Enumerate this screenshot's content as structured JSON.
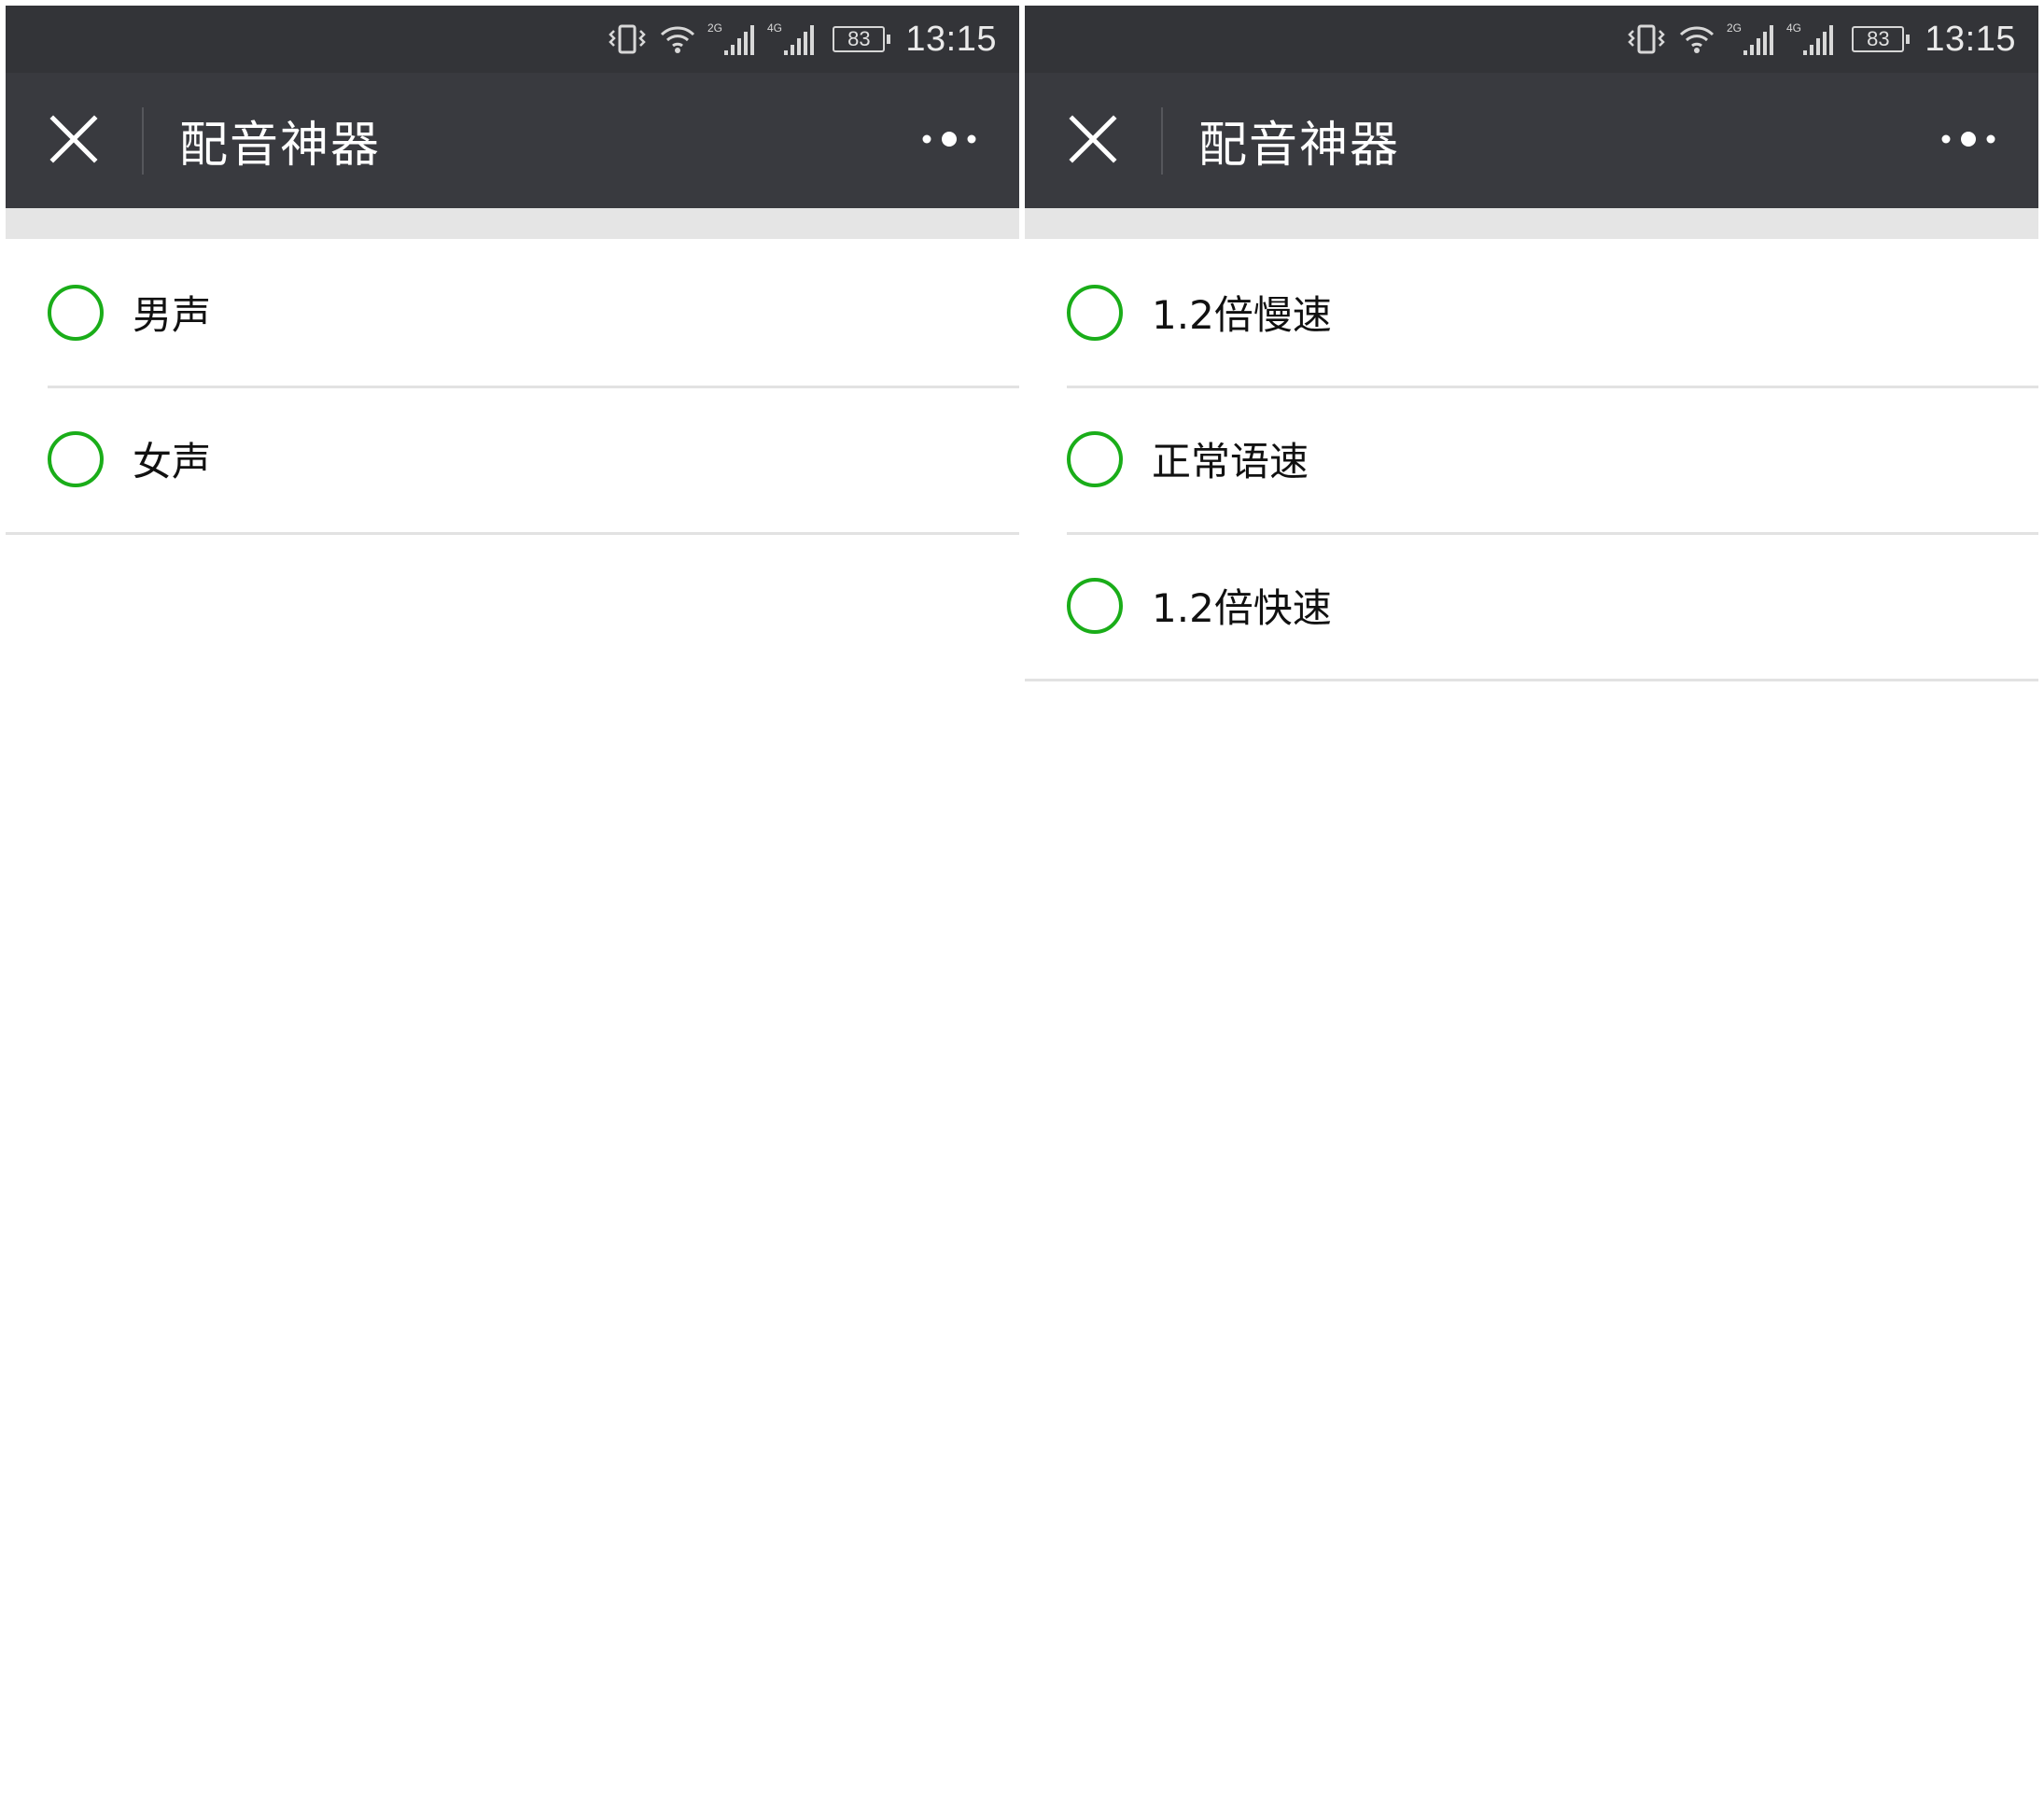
{
  "screens": [
    {
      "status": {
        "battery": "83",
        "time": "13:15",
        "net1": "2G",
        "net2": "4G"
      },
      "nav": {
        "title": "配音神器"
      },
      "options": [
        {
          "label": "男声"
        },
        {
          "label": "女声"
        }
      ]
    },
    {
      "status": {
        "battery": "83",
        "time": "13:15",
        "net1": "2G",
        "net2": "4G"
      },
      "nav": {
        "title": "配音神器"
      },
      "options": [
        {
          "label": "1.2倍慢速"
        },
        {
          "label": "正常语速"
        },
        {
          "label": "1.2倍快速"
        }
      ]
    }
  ],
  "icons": {
    "vibrate": "vibrate-icon",
    "wifi": "wifi-icon",
    "signal": "signal-icon",
    "close": "close-icon",
    "more": "more-dots-icon",
    "radio": "radio-unchecked-icon"
  },
  "colors": {
    "status_bar": "#333438",
    "nav_bar": "#393a3f",
    "accent_green": "#1aad19",
    "divider": "#e2e2e2",
    "strip": "#e5e5e5"
  }
}
